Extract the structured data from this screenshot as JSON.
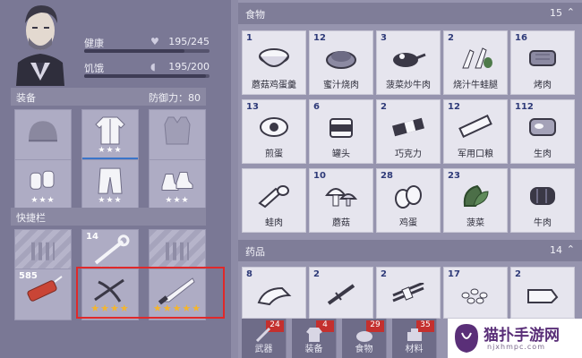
{
  "status": {
    "health": {
      "label": "健康",
      "value": "195/245",
      "fraction": 0.8
    },
    "hunger": {
      "label": "饥饿",
      "value": "195/200",
      "fraction": 0.97
    }
  },
  "equipment": {
    "title": "装备",
    "defense_label": "防御力：",
    "defense_value": "80",
    "slots": [
      {
        "icon": "helmet-icon",
        "stars": ""
      },
      {
        "icon": "jacket-icon",
        "stars": "★★★"
      },
      {
        "icon": "vest-icon",
        "stars": ""
      },
      {
        "icon": "gloves-icon",
        "stars": "★★★"
      },
      {
        "icon": "pants-icon",
        "stars": "★★★"
      },
      {
        "icon": "shoes-icon",
        "stars": "★★★"
      }
    ]
  },
  "quickbar": {
    "title": "快捷栏",
    "slots": [
      {
        "icon": "empty-slot-icon",
        "count": "",
        "stars": ""
      },
      {
        "icon": "wrench-icon",
        "count": "14",
        "stars": "★★★"
      },
      {
        "icon": "empty-slot-icon",
        "count": "",
        "stars": ""
      },
      {
        "icon": "dynamite-icon",
        "count": "585",
        "stars": ""
      },
      {
        "icon": "crossbow-icon",
        "count": "",
        "stars": "★★★★"
      },
      {
        "icon": "machete-icon",
        "count": "",
        "stars": "★★★★★"
      }
    ]
  },
  "food": {
    "title": "食物",
    "count": "15",
    "items": [
      {
        "count": "1",
        "name": "蘑菇鸡蛋羹",
        "icon": "soup-bowl-icon"
      },
      {
        "count": "12",
        "name": "蜜汁烧肉",
        "icon": "roast-meat-icon"
      },
      {
        "count": "3",
        "name": "菠菜炒牛肉",
        "icon": "stir-fry-icon"
      },
      {
        "count": "2",
        "name": "烧汁牛蛙腿",
        "icon": "frog-legs-icon"
      },
      {
        "count": "16",
        "name": "烤肉",
        "icon": "steak-icon"
      },
      {
        "count": "13",
        "name": "煎蛋",
        "icon": "fried-egg-icon"
      },
      {
        "count": "6",
        "name": "罐头",
        "icon": "can-icon"
      },
      {
        "count": "2",
        "name": "巧克力",
        "icon": "chocolate-icon"
      },
      {
        "count": "12",
        "name": "军用口粮",
        "icon": "ration-icon"
      },
      {
        "count": "112",
        "name": "生肉",
        "icon": "raw-meat-icon"
      },
      {
        "count": "",
        "name": "蛙肉",
        "icon": "frog-meat-icon"
      },
      {
        "count": "10",
        "name": "蘑菇",
        "icon": "mushroom-icon"
      },
      {
        "count": "28",
        "name": "鸡蛋",
        "icon": "eggs-icon"
      },
      {
        "count": "23",
        "name": "菠菜",
        "icon": "spinach-icon"
      },
      {
        "count": "",
        "name": "牛肉",
        "icon": "beef-icon"
      }
    ]
  },
  "medicine": {
    "title": "药品",
    "count": "14",
    "items": [
      {
        "count": "8",
        "icon": "cast-icon"
      },
      {
        "count": "2",
        "icon": "syringe-icon"
      },
      {
        "count": "2",
        "icon": "splint-icon"
      },
      {
        "count": "17",
        "icon": "pills-icon"
      },
      {
        "count": "2",
        "icon": "bandage-icon"
      }
    ]
  },
  "tabs": [
    {
      "label": "武器",
      "badge": "24",
      "icon": "weapon-tab-icon"
    },
    {
      "label": "装备",
      "badge": "4",
      "icon": "clothing-tab-icon"
    },
    {
      "label": "食物",
      "badge": "29",
      "icon": "food-tab-icon"
    },
    {
      "label": "材料",
      "badge": "35",
      "icon": "materials-tab-icon"
    }
  ],
  "watermark": {
    "name": "猫扑手游网",
    "url": "njxhmpc.com"
  },
  "colors": {
    "highlight_border": "#e0292a",
    "gold_stars": "#f3b52f",
    "badge": "#c4302e"
  }
}
